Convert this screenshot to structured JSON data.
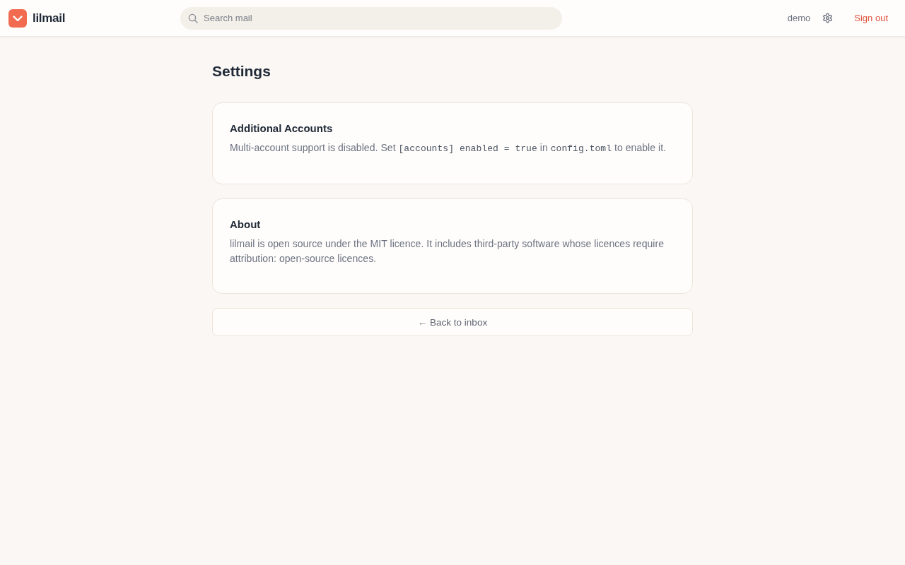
{
  "header": {
    "logo_text": "lilmail",
    "search": {
      "placeholder": "Search mail"
    },
    "user": "demo",
    "sign_out": "Sign out"
  },
  "page": {
    "title": "Settings"
  },
  "sections": [
    {
      "title": "Additional Accounts",
      "body": [
        {
          "kind": "text",
          "text": "Multi-account support is disabled. Set "
        },
        {
          "kind": "code",
          "text": "[accounts] enabled = true"
        },
        {
          "kind": "text",
          "text": " in "
        },
        {
          "kind": "code",
          "text": "config.toml"
        },
        {
          "kind": "text",
          "text": " to enable it."
        }
      ]
    },
    {
      "title": "About",
      "body": [
        {
          "kind": "text",
          "text": "lilmail is open source under the MIT licence. It includes third-party software whose licences require attribution: open-source licences."
        }
      ]
    }
  ],
  "back_button": "← Back to inbox"
}
